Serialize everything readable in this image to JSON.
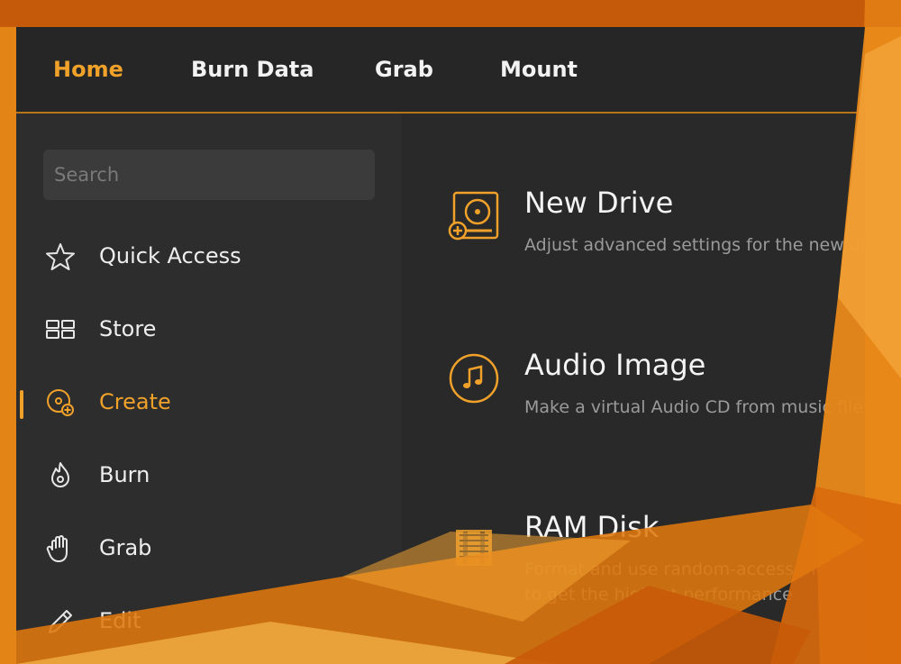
{
  "colors": {
    "accent": "#f0a12a",
    "window_bg": "#2b2b2b",
    "wallpaper": "#d86a10"
  },
  "topnav": {
    "tabs": [
      {
        "label": "Home",
        "active": true
      },
      {
        "label": "Burn Data",
        "active": false
      },
      {
        "label": "Grab",
        "active": false
      },
      {
        "label": "Mount",
        "active": false
      }
    ]
  },
  "sidebar": {
    "search": {
      "placeholder": "Search",
      "value": ""
    },
    "items": [
      {
        "label": "Quick Access",
        "icon": "star-icon",
        "active": false
      },
      {
        "label": "Store",
        "icon": "grid-icon",
        "active": false
      },
      {
        "label": "Create",
        "icon": "create-disc-icon",
        "active": true
      },
      {
        "label": "Burn",
        "icon": "flame-disc-icon",
        "active": false
      },
      {
        "label": "Grab",
        "icon": "hand-icon",
        "active": false
      },
      {
        "label": "Edit",
        "icon": "pencil-icon",
        "active": false
      }
    ]
  },
  "main": {
    "features": [
      {
        "title": "New Drive",
        "description": "Adjust advanced settings for the new drive",
        "icon": "new-drive-icon"
      },
      {
        "title": "Audio Image",
        "description": "Make a virtual Audio CD from music files",
        "icon": "audio-image-icon"
      },
      {
        "title": "RAM Disk",
        "description": "Format and use random-access memory",
        "description2": "to get the highest performance",
        "icon": "ram-disk-icon"
      }
    ]
  }
}
